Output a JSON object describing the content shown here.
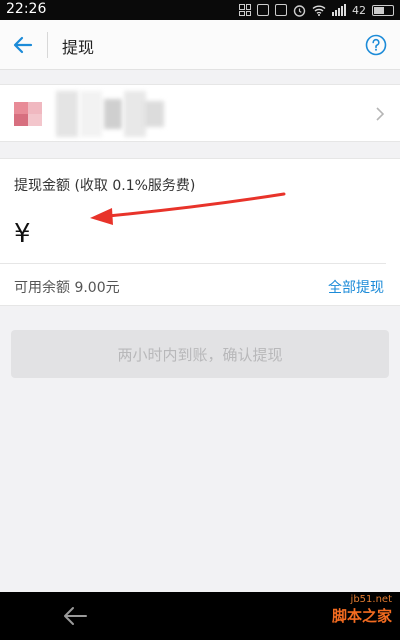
{
  "status_bar": {
    "time": "22:26",
    "battery": "42"
  },
  "header": {
    "title": "提现"
  },
  "amount": {
    "label": "提现金额 (收取 0.1%服务费)",
    "currency_symbol": "¥",
    "input_value": "",
    "balance_text": "可用余额 9.00元",
    "withdraw_all_label": "全部提现"
  },
  "confirm": {
    "label": "两小时内到账，确认提现"
  },
  "watermark": {
    "url": "jb51.net",
    "text": "脚本之家"
  },
  "colors": {
    "accent": "#1c8bd8",
    "annotation_arrow": "#e8332a",
    "watermark": "#f36b20"
  },
  "icons": {
    "back": "arrow-left-icon",
    "help": "help-circle-icon",
    "chevron": "chevron-right-icon",
    "nav_back": "nav-back-icon"
  }
}
